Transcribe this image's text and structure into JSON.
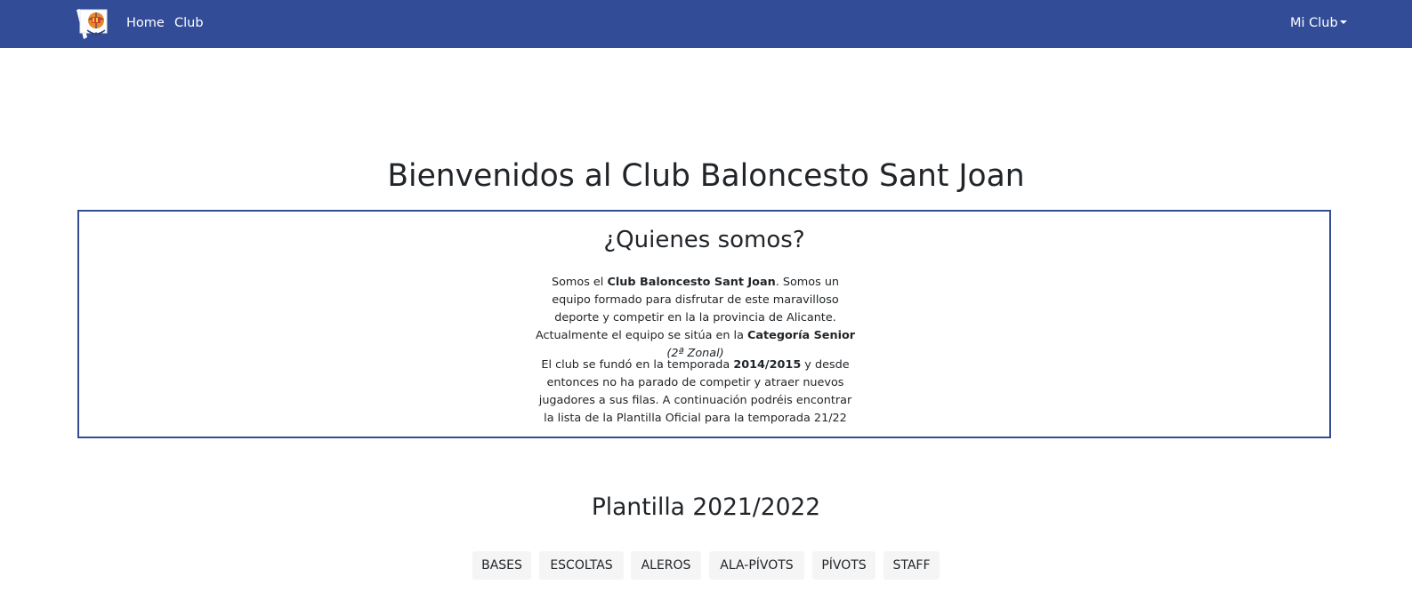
{
  "nav": {
    "home": "Home",
    "club": "Club",
    "mi_club": "Mi Club"
  },
  "header": {
    "title": "Bienvenidos al Club Baloncesto Sant Joan"
  },
  "about": {
    "title": "¿Quienes somos?",
    "p1": {
      "t1": "Somos el ",
      "b1": "Club Baloncesto Sant Joan",
      "t2": ". Somos un equipo formado para disfrutar de este maravilloso deporte y competir en la la provincia de Alicante. Actualmente el equipo se sitúa en la ",
      "b2": "Categoría Senior",
      "i1": " (2ª Zonal)"
    },
    "p2": {
      "t1": "El club se fundó en la temporada ",
      "b1": "2014/2015",
      "t2": " y desde entonces no ha parado de competir y atraer nuevos jugadores a sus filas. A continuación podréis encontrar la lista de la Plantilla Oficial para la temporada 21/22"
    }
  },
  "roster": {
    "title": "Plantilla 2021/2022",
    "tabs": [
      "BASES",
      "ESCOLTAS",
      "ALEROS",
      "ALA-PÍVOTS",
      "PÍVOTS",
      "STAFF"
    ]
  },
  "colors": {
    "navbar": "#324c97",
    "box_border": "#324c97",
    "tab_bg": "#f5f5f5"
  }
}
